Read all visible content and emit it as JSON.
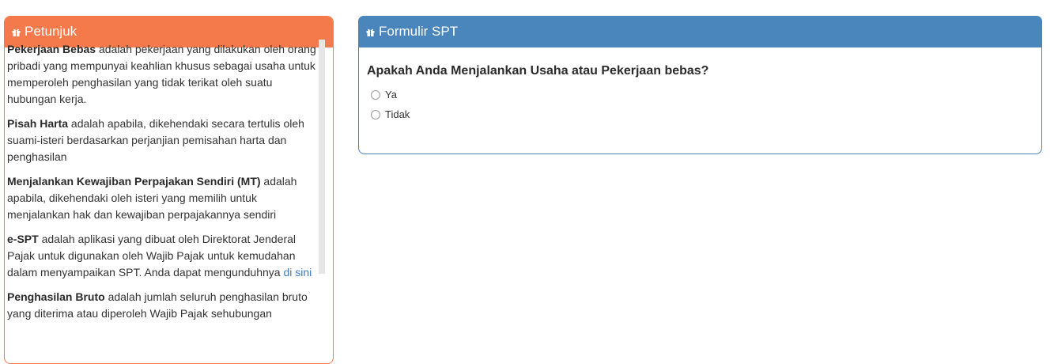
{
  "petunjuk": {
    "title": "Petunjuk",
    "icon": "gift-icon",
    "color": "#f47a4c",
    "items": [
      {
        "term": "Pekerjaan Bebas",
        "desc": " adalah pekerjaan yang dilakukan oleh orang pribadi yang mempunyai keahlian khusus sebagai usaha untuk memperoleh penghasilan yang tidak terikat oleh suatu hubungan kerja."
      },
      {
        "term": "Pisah Harta",
        "desc": " adalah apabila, dikehendaki secara tertulis oleh suami-isteri berdasarkan perjanjian pemisahan harta dan penghasilan"
      },
      {
        "term": "Menjalankan Kewajiban Perpajakan Sendiri (MT)",
        "desc": " adalah apabila, dikehendaki oleh isteri yang memilih untuk menjalankan hak dan kewajiban perpajakannya sendiri"
      },
      {
        "term": "e-SPT",
        "desc": " adalah aplikasi yang dibuat oleh Direktorat Jenderal Pajak untuk digunakan oleh Wajib Pajak untuk kemudahan dalam menyampaikan SPT. Anda dapat mengunduhnya ",
        "link": "di sini"
      },
      {
        "term": "Penghasilan Bruto",
        "desc": " adalah jumlah seluruh penghasilan bruto yang diterima atau diperoleh Wajib Pajak sehubungan"
      }
    ]
  },
  "formulir": {
    "title": "Formulir SPT",
    "icon": "gift-icon",
    "color": "#4a86bb",
    "question": "Apakah Anda Menjalankan Usaha atau Pekerjaan bebas?",
    "options": [
      "Ya",
      "Tidak"
    ]
  }
}
